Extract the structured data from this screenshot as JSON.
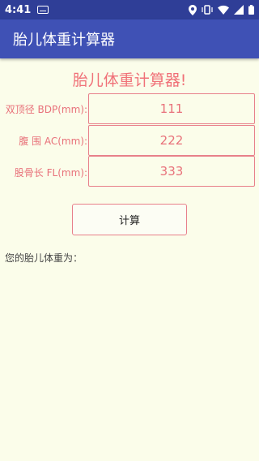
{
  "status_bar": {
    "time": "4:41",
    "icons": [
      "keyboard-icon",
      "location-icon",
      "vibrate-icon",
      "wifi-icon",
      "signal-icon",
      "battery-icon"
    ]
  },
  "app_bar": {
    "title": "胎儿体重计算器"
  },
  "heading": "胎儿体重计算器!",
  "form": {
    "bdp": {
      "label": "双顶径 BDP(mm):",
      "value": "111"
    },
    "ac": {
      "label": "腹  围 AC(mm):",
      "value": "222"
    },
    "fl": {
      "label": "股骨长 FL(mm):",
      "value": "333"
    }
  },
  "calculate_button": "计算",
  "result_label": "您的胎儿体重为：",
  "colors": {
    "status_bar": "#2f3e97",
    "app_bar": "#3f51b5",
    "background": "#fbfdea",
    "accent_text": "#f07178",
    "field_border": "#e8808a"
  }
}
